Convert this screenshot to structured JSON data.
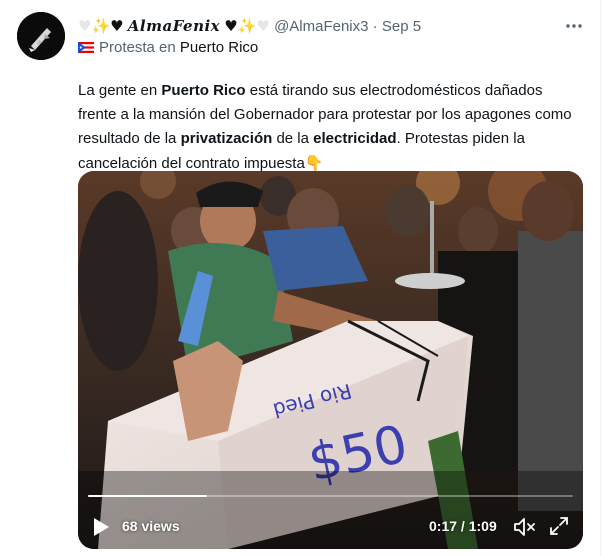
{
  "author": {
    "name_prefix_icons": [
      "white-heart-icon",
      "sparkles-icon",
      "black-heart-icon"
    ],
    "display_name": "AlmaFenix",
    "name_suffix_icons": [
      "black-heart-icon",
      "sparkles-icon",
      "white-heart-icon"
    ],
    "handle": "@AlmaFenix3",
    "separator": "·",
    "date": "Sep 5"
  },
  "more_button": {
    "icon": "more-icon",
    "label": "···"
  },
  "location": {
    "flag_icon": "puerto-rico-flag-icon",
    "prefix": "Protesta en",
    "place": "Puerto Rico"
  },
  "tweet_text": {
    "p1": "La gente en ",
    "b1": "Puerto Rico",
    "p2": " está tirando sus electrodomésticos dañados frente a la mansión del Gobernador para protestar por los apagones como resultado de la ",
    "b2": "privatización",
    "p3": " de la ",
    "b3": "electricidad",
    "p4": ".  Protestas piden la cancelación del contrato impuesta",
    "emoji_icon": "pointing-down-icon",
    "emoji": "👇"
  },
  "video": {
    "views": "68 views",
    "current_time": "0:17",
    "time_separator": " / ",
    "duration": "1:09",
    "progress": 0.246,
    "play_icon": "play-icon",
    "mute_icon": "mute-icon",
    "fullscreen_icon": "fullscreen-icon",
    "appliance_writing_1": "$50",
    "appliance_writing_2": "Rio Pied"
  },
  "colors": {
    "text": "#0f1419",
    "muted": "#536471",
    "border": "#eff3f4"
  }
}
